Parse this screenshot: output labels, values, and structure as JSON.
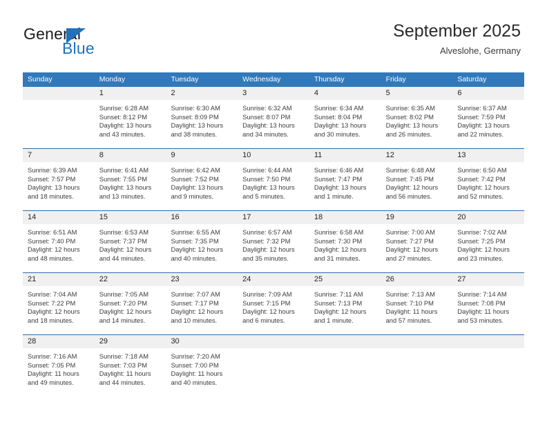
{
  "brand": {
    "name_part1": "General",
    "name_part2": "Blue"
  },
  "header": {
    "title": "September 2025",
    "subtitle": "Alveslohe, Germany"
  },
  "colors": {
    "header_blue": "#3279bb",
    "separator_blue": "#2b6ca8",
    "daynum_gray": "#f0f0f0",
    "brand_blue": "#1f72bb"
  },
  "weekdays": [
    "Sunday",
    "Monday",
    "Tuesday",
    "Wednesday",
    "Thursday",
    "Friday",
    "Saturday"
  ],
  "labels": {
    "sunrise": "Sunrise:",
    "sunset": "Sunset:",
    "daylight": "Daylight:"
  },
  "weeks": [
    [
      {
        "day": "",
        "sunrise": "",
        "sunset": "",
        "daylight1": "",
        "daylight2": ""
      },
      {
        "day": "1",
        "sunrise": "Sunrise: 6:28 AM",
        "sunset": "Sunset: 8:12 PM",
        "daylight1": "Daylight: 13 hours",
        "daylight2": "and 43 minutes."
      },
      {
        "day": "2",
        "sunrise": "Sunrise: 6:30 AM",
        "sunset": "Sunset: 8:09 PM",
        "daylight1": "Daylight: 13 hours",
        "daylight2": "and 38 minutes."
      },
      {
        "day": "3",
        "sunrise": "Sunrise: 6:32 AM",
        "sunset": "Sunset: 8:07 PM",
        "daylight1": "Daylight: 13 hours",
        "daylight2": "and 34 minutes."
      },
      {
        "day": "4",
        "sunrise": "Sunrise: 6:34 AM",
        "sunset": "Sunset: 8:04 PM",
        "daylight1": "Daylight: 13 hours",
        "daylight2": "and 30 minutes."
      },
      {
        "day": "5",
        "sunrise": "Sunrise: 6:35 AM",
        "sunset": "Sunset: 8:02 PM",
        "daylight1": "Daylight: 13 hours",
        "daylight2": "and 26 minutes."
      },
      {
        "day": "6",
        "sunrise": "Sunrise: 6:37 AM",
        "sunset": "Sunset: 7:59 PM",
        "daylight1": "Daylight: 13 hours",
        "daylight2": "and 22 minutes."
      }
    ],
    [
      {
        "day": "7",
        "sunrise": "Sunrise: 6:39 AM",
        "sunset": "Sunset: 7:57 PM",
        "daylight1": "Daylight: 13 hours",
        "daylight2": "and 18 minutes."
      },
      {
        "day": "8",
        "sunrise": "Sunrise: 6:41 AM",
        "sunset": "Sunset: 7:55 PM",
        "daylight1": "Daylight: 13 hours",
        "daylight2": "and 13 minutes."
      },
      {
        "day": "9",
        "sunrise": "Sunrise: 6:42 AM",
        "sunset": "Sunset: 7:52 PM",
        "daylight1": "Daylight: 13 hours",
        "daylight2": "and 9 minutes."
      },
      {
        "day": "10",
        "sunrise": "Sunrise: 6:44 AM",
        "sunset": "Sunset: 7:50 PM",
        "daylight1": "Daylight: 13 hours",
        "daylight2": "and 5 minutes."
      },
      {
        "day": "11",
        "sunrise": "Sunrise: 6:46 AM",
        "sunset": "Sunset: 7:47 PM",
        "daylight1": "Daylight: 13 hours",
        "daylight2": "and 1 minute."
      },
      {
        "day": "12",
        "sunrise": "Sunrise: 6:48 AM",
        "sunset": "Sunset: 7:45 PM",
        "daylight1": "Daylight: 12 hours",
        "daylight2": "and 56 minutes."
      },
      {
        "day": "13",
        "sunrise": "Sunrise: 6:50 AM",
        "sunset": "Sunset: 7:42 PM",
        "daylight1": "Daylight: 12 hours",
        "daylight2": "and 52 minutes."
      }
    ],
    [
      {
        "day": "14",
        "sunrise": "Sunrise: 6:51 AM",
        "sunset": "Sunset: 7:40 PM",
        "daylight1": "Daylight: 12 hours",
        "daylight2": "and 48 minutes."
      },
      {
        "day": "15",
        "sunrise": "Sunrise: 6:53 AM",
        "sunset": "Sunset: 7:37 PM",
        "daylight1": "Daylight: 12 hours",
        "daylight2": "and 44 minutes."
      },
      {
        "day": "16",
        "sunrise": "Sunrise: 6:55 AM",
        "sunset": "Sunset: 7:35 PM",
        "daylight1": "Daylight: 12 hours",
        "daylight2": "and 40 minutes."
      },
      {
        "day": "17",
        "sunrise": "Sunrise: 6:57 AM",
        "sunset": "Sunset: 7:32 PM",
        "daylight1": "Daylight: 12 hours",
        "daylight2": "and 35 minutes."
      },
      {
        "day": "18",
        "sunrise": "Sunrise: 6:58 AM",
        "sunset": "Sunset: 7:30 PM",
        "daylight1": "Daylight: 12 hours",
        "daylight2": "and 31 minutes."
      },
      {
        "day": "19",
        "sunrise": "Sunrise: 7:00 AM",
        "sunset": "Sunset: 7:27 PM",
        "daylight1": "Daylight: 12 hours",
        "daylight2": "and 27 minutes."
      },
      {
        "day": "20",
        "sunrise": "Sunrise: 7:02 AM",
        "sunset": "Sunset: 7:25 PM",
        "daylight1": "Daylight: 12 hours",
        "daylight2": "and 23 minutes."
      }
    ],
    [
      {
        "day": "21",
        "sunrise": "Sunrise: 7:04 AM",
        "sunset": "Sunset: 7:22 PM",
        "daylight1": "Daylight: 12 hours",
        "daylight2": "and 18 minutes."
      },
      {
        "day": "22",
        "sunrise": "Sunrise: 7:05 AM",
        "sunset": "Sunset: 7:20 PM",
        "daylight1": "Daylight: 12 hours",
        "daylight2": "and 14 minutes."
      },
      {
        "day": "23",
        "sunrise": "Sunrise: 7:07 AM",
        "sunset": "Sunset: 7:17 PM",
        "daylight1": "Daylight: 12 hours",
        "daylight2": "and 10 minutes."
      },
      {
        "day": "24",
        "sunrise": "Sunrise: 7:09 AM",
        "sunset": "Sunset: 7:15 PM",
        "daylight1": "Daylight: 12 hours",
        "daylight2": "and 6 minutes."
      },
      {
        "day": "25",
        "sunrise": "Sunrise: 7:11 AM",
        "sunset": "Sunset: 7:13 PM",
        "daylight1": "Daylight: 12 hours",
        "daylight2": "and 1 minute."
      },
      {
        "day": "26",
        "sunrise": "Sunrise: 7:13 AM",
        "sunset": "Sunset: 7:10 PM",
        "daylight1": "Daylight: 11 hours",
        "daylight2": "and 57 minutes."
      },
      {
        "day": "27",
        "sunrise": "Sunrise: 7:14 AM",
        "sunset": "Sunset: 7:08 PM",
        "daylight1": "Daylight: 11 hours",
        "daylight2": "and 53 minutes."
      }
    ],
    [
      {
        "day": "28",
        "sunrise": "Sunrise: 7:16 AM",
        "sunset": "Sunset: 7:05 PM",
        "daylight1": "Daylight: 11 hours",
        "daylight2": "and 49 minutes."
      },
      {
        "day": "29",
        "sunrise": "Sunrise: 7:18 AM",
        "sunset": "Sunset: 7:03 PM",
        "daylight1": "Daylight: 11 hours",
        "daylight2": "and 44 minutes."
      },
      {
        "day": "30",
        "sunrise": "Sunrise: 7:20 AM",
        "sunset": "Sunset: 7:00 PM",
        "daylight1": "Daylight: 11 hours",
        "daylight2": "and 40 minutes."
      },
      {
        "day": "",
        "sunrise": "",
        "sunset": "",
        "daylight1": "",
        "daylight2": ""
      },
      {
        "day": "",
        "sunrise": "",
        "sunset": "",
        "daylight1": "",
        "daylight2": ""
      },
      {
        "day": "",
        "sunrise": "",
        "sunset": "",
        "daylight1": "",
        "daylight2": ""
      },
      {
        "day": "",
        "sunrise": "",
        "sunset": "",
        "daylight1": "",
        "daylight2": ""
      }
    ]
  ]
}
